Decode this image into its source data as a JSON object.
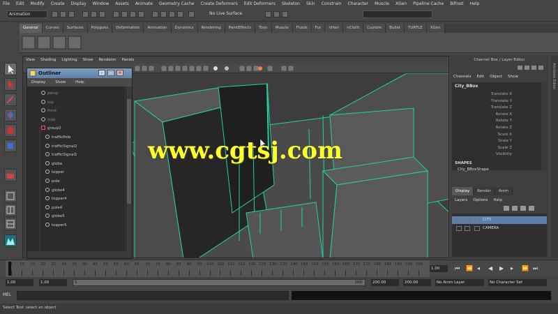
{
  "menubar": [
    "File",
    "Edit",
    "Modify",
    "Create",
    "Display",
    "Window",
    "Assets",
    "Animate",
    "Geometry Cache",
    "Create Deformers",
    "Edit Deformers",
    "Skeleton",
    "Skin",
    "Constrain",
    "Character",
    "Muscle",
    "XGen",
    "Pipeline Cache",
    "Bifrost",
    "Help"
  ],
  "status": {
    "mode": "Animation",
    "no_live": "No Live Surface"
  },
  "shelf_tabs": [
    "General",
    "Curves",
    "Surfaces",
    "Polygons",
    "Deformation",
    "Animation",
    "Dynamics",
    "Rendering",
    "PaintEffects",
    "Toon",
    "Muscle",
    "Fluids",
    "Fur",
    "nHair",
    "nCloth",
    "Custom",
    "Bullet",
    "TURTLE",
    "XGen"
  ],
  "shelf_active": "General",
  "viewport_menu": [
    "View",
    "Shading",
    "Lighting",
    "Show",
    "Renderer",
    "Panels"
  ],
  "outliner": {
    "title": "Outliner",
    "menu": [
      "Display",
      "Show",
      "Help"
    ],
    "items": [
      {
        "label": "persp",
        "indent": 0,
        "dim": true
      },
      {
        "label": "top",
        "indent": 0,
        "dim": true
      },
      {
        "label": "front",
        "indent": 0,
        "dim": true
      },
      {
        "label": "side",
        "indent": 0,
        "dim": true
      },
      {
        "label": "group2",
        "indent": 0,
        "dim": false
      },
      {
        "label": "trafficPole",
        "indent": 1,
        "dim": false
      },
      {
        "label": "trafficSignal2",
        "indent": 1,
        "dim": false
      },
      {
        "label": "trafficSignal1",
        "indent": 1,
        "dim": false
      },
      {
        "label": "globe",
        "indent": 1,
        "dim": false
      },
      {
        "label": "topper",
        "indent": 1,
        "dim": false
      },
      {
        "label": "pole",
        "indent": 1,
        "dim": false
      },
      {
        "label": "globe4",
        "indent": 1,
        "dim": false
      },
      {
        "label": "topper4",
        "indent": 1,
        "dim": false
      },
      {
        "label": "pole4",
        "indent": 1,
        "dim": false
      },
      {
        "label": "globe5",
        "indent": 1,
        "dim": false
      },
      {
        "label": "topper5",
        "indent": 1,
        "dim": false
      }
    ]
  },
  "watermark": "www.cgtsj.com",
  "channel_box": {
    "title": "Channel Box / Layer Editor",
    "menu": [
      "Channels",
      "Edit",
      "Object",
      "Show"
    ],
    "object": "City_BBox",
    "attributes": [
      "Translate X",
      "Translate Y",
      "Translate Z",
      "Rotate X",
      "Rotate Y",
      "Rotate Z",
      "Scale X",
      "Scale Y",
      "Scale Z",
      "Visibility"
    ],
    "shapes_label": "SHAPES",
    "shape_name": "City_BBoxShape"
  },
  "layers": {
    "tabs": [
      "Display",
      "Render",
      "Anim"
    ],
    "tab_active": "Display",
    "menu": [
      "Layers",
      "Options",
      "Help"
    ],
    "rows": [
      {
        "name": "CITY",
        "selected": true
      },
      {
        "name": "CAMERA",
        "selected": false
      }
    ]
  },
  "timeline": {
    "ticks": [
      "1",
      "10",
      "15",
      "20",
      "25",
      "30",
      "35",
      "40",
      "45",
      "50",
      "55",
      "60",
      "65",
      "70",
      "75",
      "80",
      "85",
      "90",
      "95",
      "100",
      "105",
      "110",
      "115",
      "120",
      "125",
      "130",
      "135",
      "140",
      "145",
      "150",
      "155",
      "160",
      "165",
      "170",
      "175",
      "180",
      "185",
      "190",
      "195",
      "200"
    ],
    "current_frame": "1.00"
  },
  "range": {
    "start": "1.00",
    "inner_start": "1.00",
    "slider_start": "1",
    "slider_end": "200",
    "inner_end": "200.00",
    "end": "200.00",
    "anim_layer": "No Anim Layer",
    "char_set": "No Character Set"
  },
  "command": {
    "label": "MEL"
  },
  "help_line": "Select Tool: select an object",
  "side_label": "Attribute Editor"
}
